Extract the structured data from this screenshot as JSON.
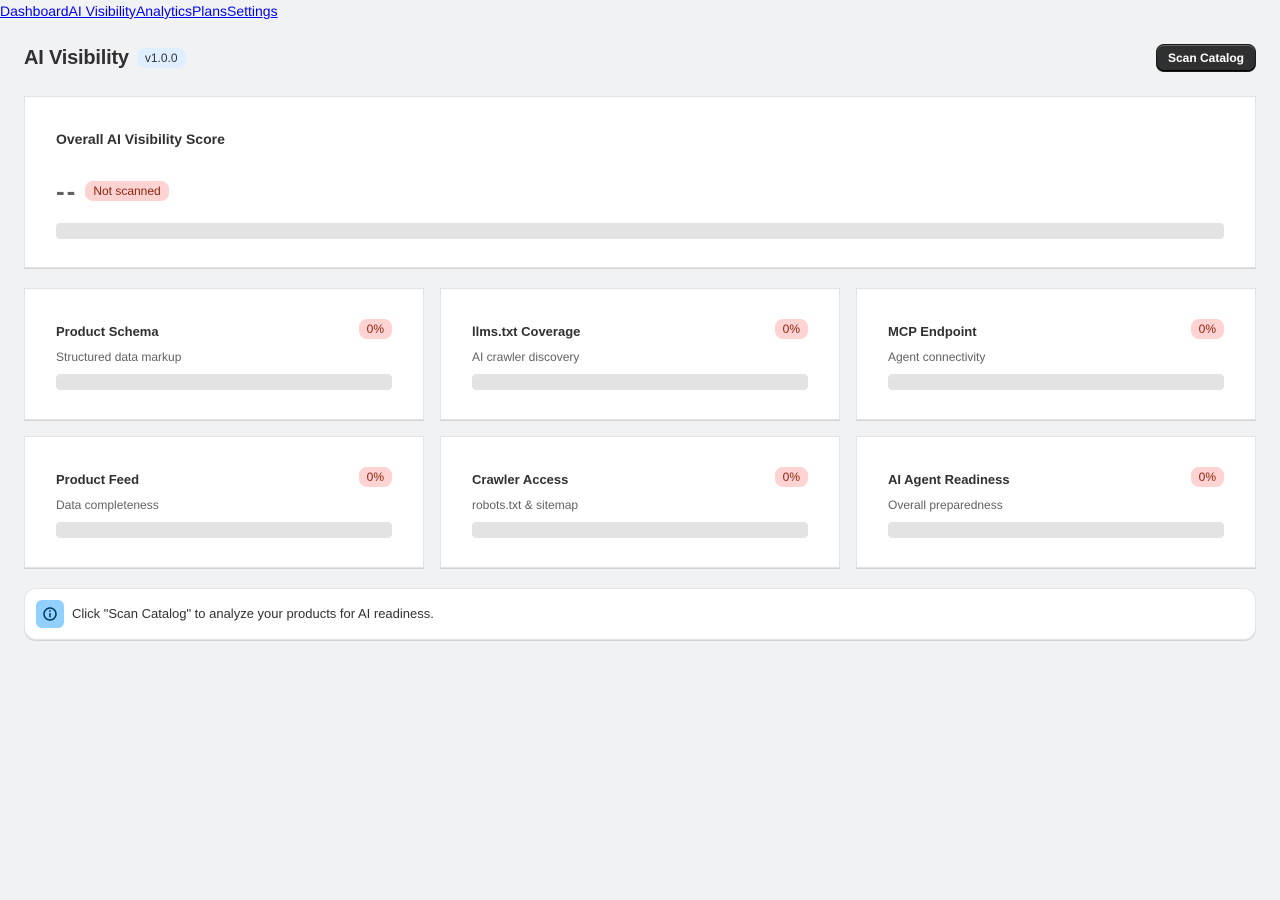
{
  "nav": {
    "items": [
      "Dashboard",
      "AI Visibility",
      "Analytics",
      "Plans",
      "Settings"
    ]
  },
  "header": {
    "title": "AI Visibility",
    "version": "v1.0.0",
    "scan_button": "Scan Catalog"
  },
  "overall": {
    "heading": "Overall AI Visibility Score",
    "score": "--",
    "status": "Not scanned",
    "progress": 0
  },
  "metrics": [
    {
      "title": "Product Schema",
      "subtitle": "Structured data markup",
      "percent": "0%",
      "progress": 0
    },
    {
      "title": "llms.txt Coverage",
      "subtitle": "AI crawler discovery",
      "percent": "0%",
      "progress": 0
    },
    {
      "title": "MCP Endpoint",
      "subtitle": "Agent connectivity",
      "percent": "0%",
      "progress": 0
    },
    {
      "title": "Product Feed",
      "subtitle": "Data completeness",
      "percent": "0%",
      "progress": 0
    },
    {
      "title": "Crawler Access",
      "subtitle": "robots.txt & sitemap",
      "percent": "0%",
      "progress": 0
    },
    {
      "title": "AI Agent Readiness",
      "subtitle": "Overall preparedness",
      "percent": "0%",
      "progress": 0
    }
  ],
  "banner": {
    "icon": "info-icon",
    "text": "Click \"Scan Catalog\" to analyze your products for AI readiness."
  },
  "colors": {
    "background": "#f1f2f4",
    "badge_critical_bg": "#fed3d1",
    "badge_critical_text": "#8e1f0b",
    "version_badge_bg": "#e0efff",
    "primary_button": "#303030",
    "info_icon_bg": "#91d0ff",
    "progress_track": "#e3e3e3"
  }
}
